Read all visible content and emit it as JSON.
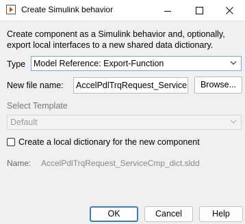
{
  "window": {
    "title": "Create Simulink behavior",
    "app_icon": "simulink-icon"
  },
  "description": "Create component as a Simulink behavior and, optionally, export local interfaces to a new shared data dictionary.",
  "type": {
    "label": "Type",
    "selected": "Model Reference: Export-Function"
  },
  "file_name": {
    "label": "New file name:",
    "value": "AccelPdlTrqRequest_Service",
    "browse_label": "Browse..."
  },
  "template": {
    "label": "Select Template",
    "selected": "Default"
  },
  "dictionary": {
    "checkbox_label": "Create a local dictionary for the new component",
    "checked": false,
    "name_label": "Name:",
    "name_value": "AccelPdlTrqRequest_ServiceCmp_dict.sldd"
  },
  "buttons": {
    "ok": "OK",
    "cancel": "Cancel",
    "help": "Help"
  }
}
